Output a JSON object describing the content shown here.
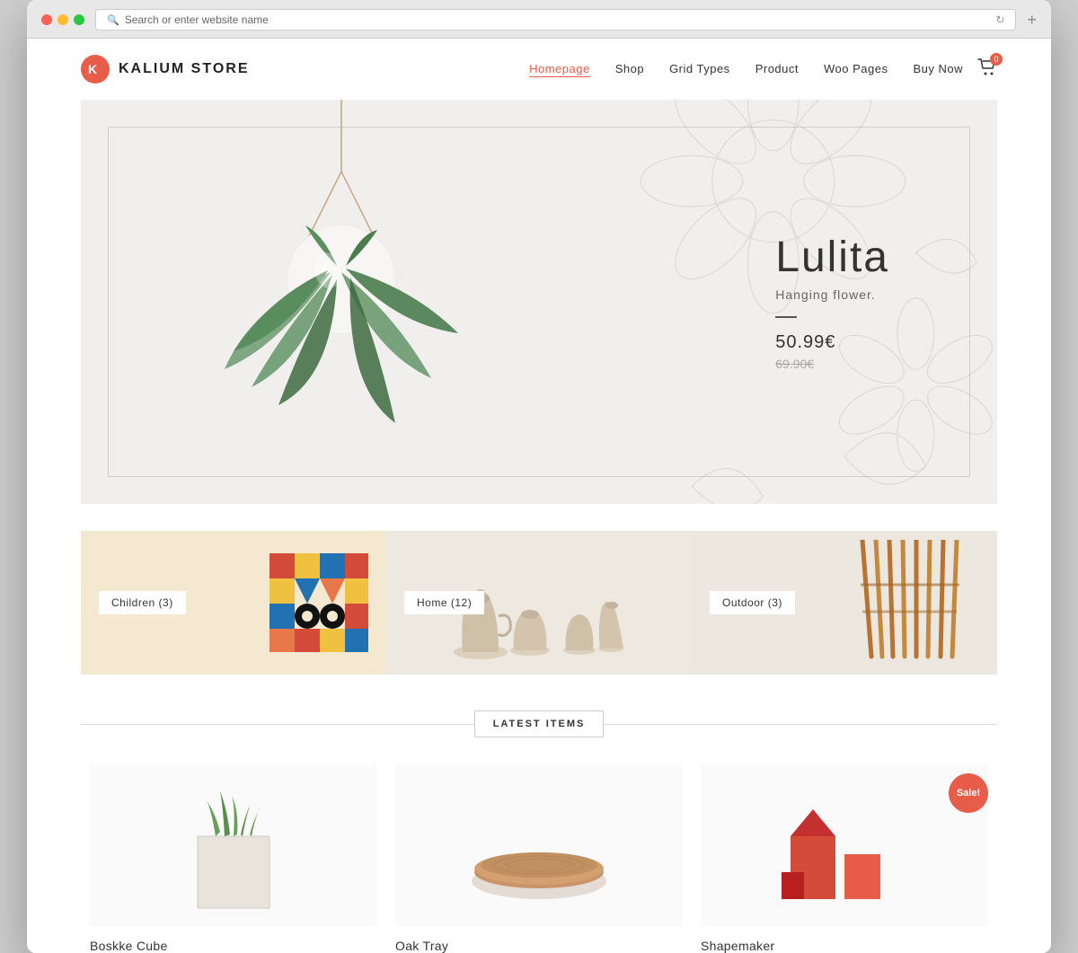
{
  "browser": {
    "address_placeholder": "Search or enter website name"
  },
  "nav": {
    "logo_text": "KALIUM STORE",
    "links": [
      {
        "label": "Homepage",
        "active": true
      },
      {
        "label": "Shop",
        "active": false
      },
      {
        "label": "Grid Types",
        "active": false
      },
      {
        "label": "Product",
        "active": false
      },
      {
        "label": "Woo Pages",
        "active": false
      },
      {
        "label": "Buy Now",
        "active": false
      }
    ],
    "cart_count": "0"
  },
  "hero": {
    "product_name": "Lulita",
    "product_subtitle": "Hanging flower.",
    "price_new": "50.99€",
    "price_old": "69.90€"
  },
  "categories": [
    {
      "label": "Children (3)"
    },
    {
      "label": "Home (12)"
    },
    {
      "label": "Outdoor (3)"
    }
  ],
  "latest_items": {
    "title": "LATEST ITEMS",
    "products": [
      {
        "name": "Boskke Cube",
        "sale": false
      },
      {
        "name": "Oak Tray",
        "sale": false
      },
      {
        "name": "Shapemaker",
        "sale": true
      }
    ]
  }
}
